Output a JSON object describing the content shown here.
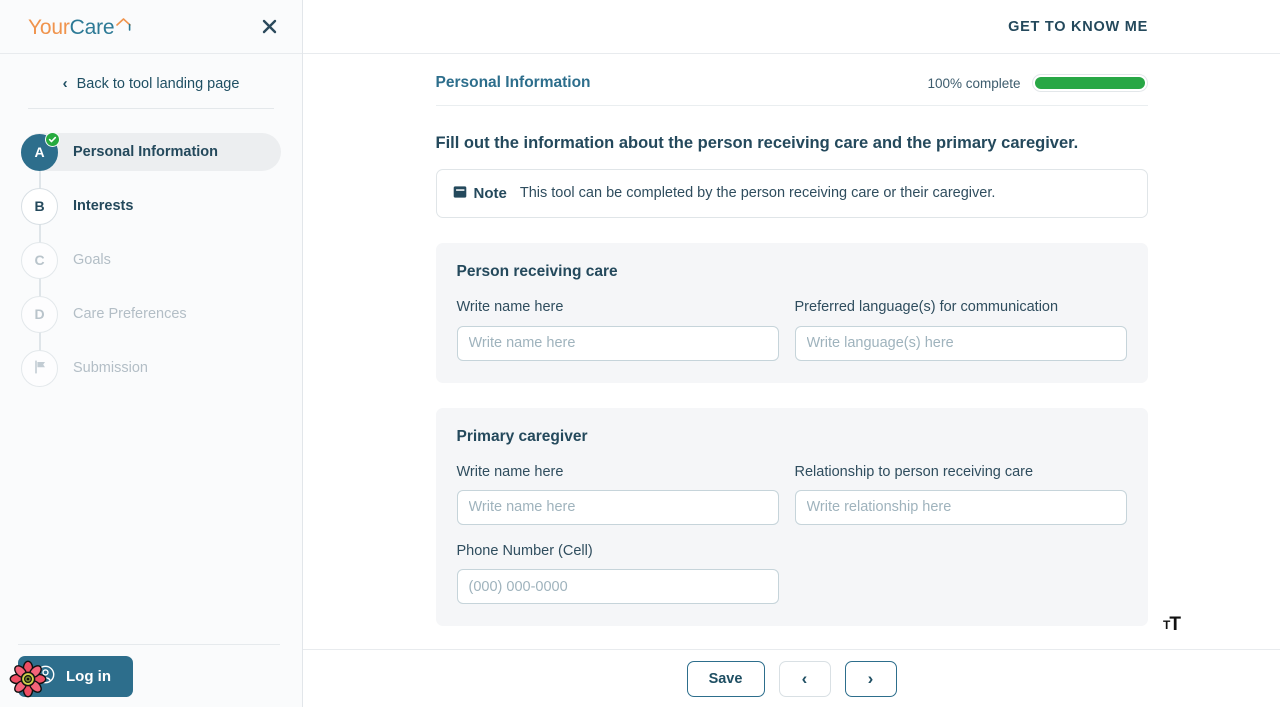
{
  "brand": {
    "name_part1": "Your",
    "name_part2": "Care",
    "logo_icon": "house-roof-icon"
  },
  "sidebar": {
    "close_icon": "close-icon",
    "back_link": "Back to tool landing page",
    "back_chevron_icon": "chevron-left-icon",
    "steps": [
      {
        "key": "A",
        "label": "Personal Information",
        "state": "active",
        "completed": true,
        "badge_icon": "check-badge-icon"
      },
      {
        "key": "B",
        "label": "Interests",
        "state": "available",
        "completed": false
      },
      {
        "key": "C",
        "label": "Goals",
        "state": "disabled",
        "completed": false
      },
      {
        "key": "D",
        "label": "Care Preferences",
        "state": "disabled",
        "completed": false
      },
      {
        "key": "flag",
        "label": "Submission",
        "state": "disabled",
        "completed": false,
        "icon": "flag-icon"
      }
    ],
    "login_button": {
      "label": "Log in",
      "icon": "user-circle-icon",
      "badge_icon": "flower-extension-icon"
    }
  },
  "header": {
    "title": "GET TO KNOW ME"
  },
  "section": {
    "title": "Personal Information",
    "progress_label": "100% complete",
    "progress_percent": 100
  },
  "instruction": "Fill out the information about the person receiving care and the primary caregiver.",
  "note": {
    "icon": "note-icon",
    "label": "Note",
    "text": "This tool can be completed by the person receiving care or their caregiver."
  },
  "cards": [
    {
      "title": "Person receiving care",
      "rows": [
        [
          {
            "label": "Write name here",
            "placeholder": "Write name here",
            "value": "",
            "name": "person-name-input"
          },
          {
            "label": "Preferred language(s) for communication",
            "placeholder": "Write language(s) here",
            "value": "",
            "name": "person-language-input"
          }
        ]
      ]
    },
    {
      "title": "Primary caregiver",
      "rows": [
        [
          {
            "label": "Write name here",
            "placeholder": "Write name here",
            "value": "",
            "name": "caregiver-name-input"
          },
          {
            "label": "Relationship to person receiving care",
            "placeholder": "Write relationship here",
            "value": "",
            "name": "caregiver-relationship-input"
          }
        ],
        [
          {
            "label": "Phone Number (Cell)",
            "placeholder": "(000) 000-0000",
            "value": "",
            "name": "caregiver-phone-input"
          }
        ]
      ]
    }
  ],
  "footer": {
    "save_label": "Save",
    "prev_label": "‹",
    "next_label": "›"
  },
  "accessibility_widget": {
    "small_t": "T",
    "big_t": "T",
    "icon": "text-size-icon"
  },
  "colors": {
    "brand_orange": "#f0944d",
    "brand_teal": "#2d7a96",
    "accent_dark": "#24495c",
    "progress_green": "#28a745",
    "card_bg": "#f5f6f8",
    "sidebar_bg": "#fafbfc"
  }
}
